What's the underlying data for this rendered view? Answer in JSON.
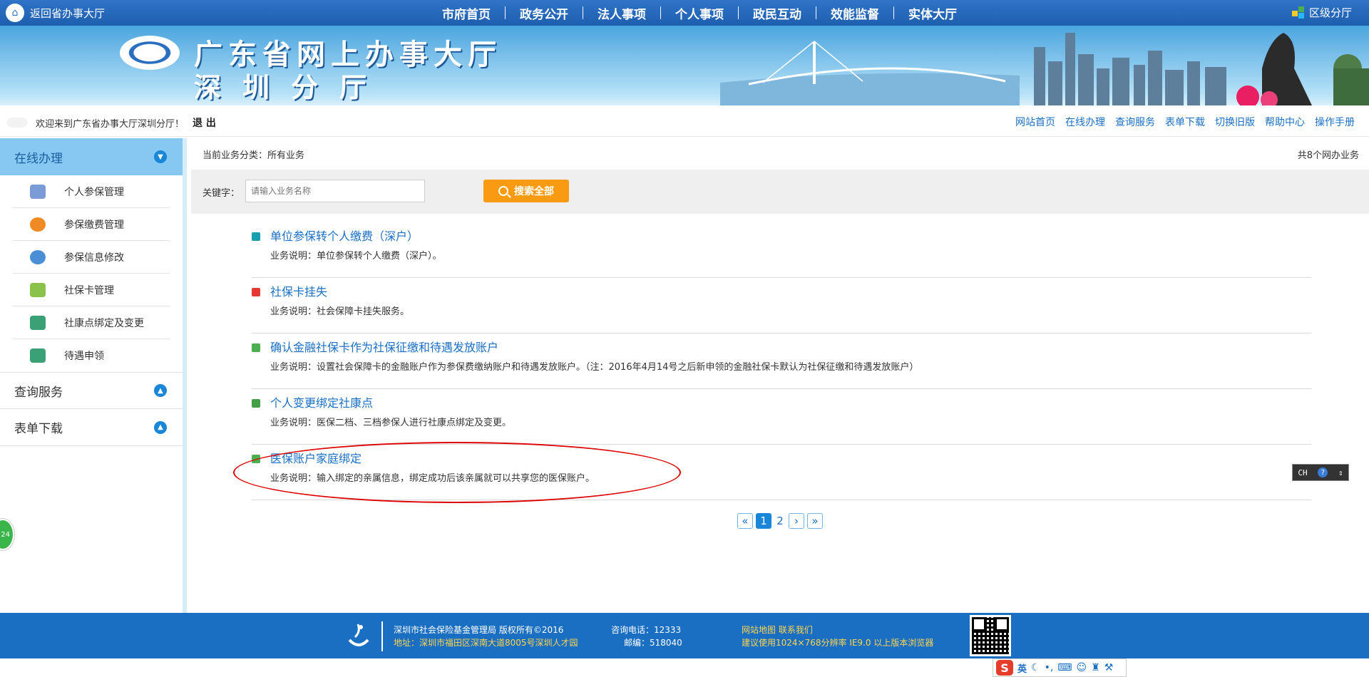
{
  "topbar": {
    "back_label": "返回省办事大厅",
    "nav": [
      "市府首页",
      "政务公开",
      "法人事项",
      "个人事项",
      "政民互动",
      "效能监督",
      "实体大厅"
    ],
    "district_label": "区级分厅"
  },
  "banner": {
    "title": "广东省网上办事大厅",
    "subtitle": "深圳分厅"
  },
  "welcome_bar": {
    "welcome": "欢迎来到广东省办事大厅深圳分厅！",
    "logout": "退 出",
    "links": [
      "网站首页",
      "在线办理",
      "查询服务",
      "表单下载",
      "切换旧版",
      "帮助中心",
      "操作手册"
    ]
  },
  "sidebar": {
    "sections": [
      {
        "label": "在线办理",
        "expanded": true
      },
      {
        "label": "查询服务",
        "expanded": false
      },
      {
        "label": "表单下载",
        "expanded": false
      }
    ],
    "items": [
      {
        "label": "个人参保管理",
        "icon": "person-shield-icon",
        "color": "#7a9bd6"
      },
      {
        "label": "参保缴费管理",
        "icon": "money-bag-icon",
        "color": "#f08a24"
      },
      {
        "label": "参保信息修改",
        "icon": "user-edit-icon",
        "color": "#4a8fd6"
      },
      {
        "label": "社保卡管理",
        "icon": "card-icon",
        "color": "#8bc34a"
      },
      {
        "label": "社康点绑定及变更",
        "icon": "house-icon",
        "color": "#3aa076"
      },
      {
        "label": "待遇申领",
        "icon": "cash-icon",
        "color": "#3aa076"
      }
    ]
  },
  "main": {
    "category_label": "当前业务分类：所有业务",
    "count_label": "共8个网办业务",
    "keyword_label": "关键字：",
    "search_placeholder": "请输入业务名称",
    "search_button": "搜索全部",
    "services": [
      {
        "title": "单位参保转个人缴费（深户）",
        "desc": "业务说明：单位参保转个人缴费（深户）。",
        "icon_color": "#1a9fb0"
      },
      {
        "title": "社保卡挂失",
        "desc": "业务说明：社会保障卡挂失服务。",
        "icon_color": "#e53935"
      },
      {
        "title": "确认金融社保卡作为社保征缴和待遇发放账户",
        "desc": "业务说明：设置社会保障卡的金融账户作为参保费缴纳账户和待遇发放账户。（注：2016年4月14号之后新申领的金融社保卡默认为社保征缴和待遇发放账户）",
        "icon_color": "#4caf50"
      },
      {
        "title": "个人变更绑定社康点",
        "desc": "业务说明：医保二档、三档参保人进行社康点绑定及变更。",
        "icon_color": "#43a047"
      },
      {
        "title": "医保账户家庭绑定",
        "desc": "业务说明：输入绑定的亲属信息，绑定成功后该亲属就可以共享您的医保账户。",
        "icon_color": "#4caf50"
      }
    ],
    "pager": {
      "first": "«",
      "prev": "‹",
      "next": "›",
      "last": "»",
      "pages": [
        "1",
        "2"
      ],
      "current": "1"
    }
  },
  "ime_widget": {
    "text": "CH",
    "help": "?"
  },
  "float_badge": {
    "text": "24"
  },
  "footer": {
    "org": "深圳市社会保险基金管理局 版权所有©2016",
    "address": "地址：深圳市福田区深南大道8005号深圳人才园",
    "phone": "咨询电话：12333",
    "postcode": "邮编：518040",
    "links": "网站地图  联系我们",
    "browser": "建议使用1024×768分辨率 IE9.0 以上版本浏览器"
  },
  "ime_bar": {
    "logo": "S",
    "lang": "英"
  }
}
